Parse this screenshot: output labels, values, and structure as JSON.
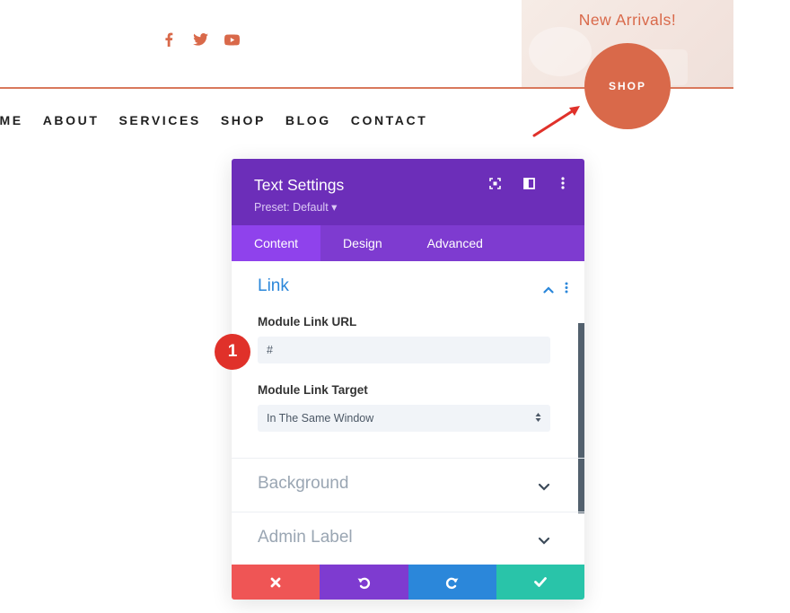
{
  "header": {
    "social_icons": [
      "facebook-icon",
      "twitter-icon",
      "youtube-icon"
    ],
    "promo_text": "New Arrivals!",
    "shop_button": "SHOP",
    "nav": [
      "OME",
      "ABOUT",
      "SERVICES",
      "SHOP",
      "BLOG",
      "CONTACT"
    ]
  },
  "panel": {
    "title": "Text Settings",
    "preset": "Preset: Default ▾",
    "tabs": [
      "Content",
      "Design",
      "Advanced"
    ],
    "active_tab": "Content",
    "sections": {
      "link": {
        "title": "Link",
        "url_label": "Module Link URL",
        "url_value": "#",
        "target_label": "Module Link Target",
        "target_value": "In The Same Window"
      },
      "background": {
        "title": "Background"
      },
      "admin_label": {
        "title": "Admin Label"
      }
    },
    "step_badge": "1"
  },
  "colors": {
    "accent": "#d9694a",
    "panel_header": "#6c2eb9",
    "tab_bar": "#7e3bd0",
    "link": "#2b87da",
    "close": "#ef5555",
    "save": "#29c4a9"
  }
}
